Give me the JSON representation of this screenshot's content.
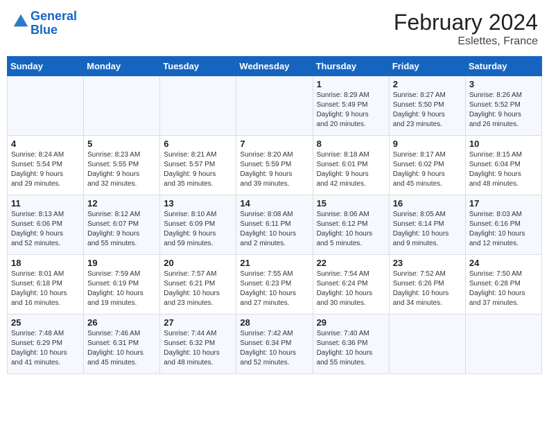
{
  "header": {
    "logo_text1": "General",
    "logo_text2": "Blue",
    "title": "February 2024",
    "subtitle": "Eslettes, France"
  },
  "days_of_week": [
    "Sunday",
    "Monday",
    "Tuesday",
    "Wednesday",
    "Thursday",
    "Friday",
    "Saturday"
  ],
  "weeks": [
    [
      {
        "day": "",
        "info": ""
      },
      {
        "day": "",
        "info": ""
      },
      {
        "day": "",
        "info": ""
      },
      {
        "day": "",
        "info": ""
      },
      {
        "day": "1",
        "info": "Sunrise: 8:29 AM\nSunset: 5:49 PM\nDaylight: 9 hours\nand 20 minutes."
      },
      {
        "day": "2",
        "info": "Sunrise: 8:27 AM\nSunset: 5:50 PM\nDaylight: 9 hours\nand 23 minutes."
      },
      {
        "day": "3",
        "info": "Sunrise: 8:26 AM\nSunset: 5:52 PM\nDaylight: 9 hours\nand 26 minutes."
      }
    ],
    [
      {
        "day": "4",
        "info": "Sunrise: 8:24 AM\nSunset: 5:54 PM\nDaylight: 9 hours\nand 29 minutes."
      },
      {
        "day": "5",
        "info": "Sunrise: 8:23 AM\nSunset: 5:55 PM\nDaylight: 9 hours\nand 32 minutes."
      },
      {
        "day": "6",
        "info": "Sunrise: 8:21 AM\nSunset: 5:57 PM\nDaylight: 9 hours\nand 35 minutes."
      },
      {
        "day": "7",
        "info": "Sunrise: 8:20 AM\nSunset: 5:59 PM\nDaylight: 9 hours\nand 39 minutes."
      },
      {
        "day": "8",
        "info": "Sunrise: 8:18 AM\nSunset: 6:01 PM\nDaylight: 9 hours\nand 42 minutes."
      },
      {
        "day": "9",
        "info": "Sunrise: 8:17 AM\nSunset: 6:02 PM\nDaylight: 9 hours\nand 45 minutes."
      },
      {
        "day": "10",
        "info": "Sunrise: 8:15 AM\nSunset: 6:04 PM\nDaylight: 9 hours\nand 48 minutes."
      }
    ],
    [
      {
        "day": "11",
        "info": "Sunrise: 8:13 AM\nSunset: 6:06 PM\nDaylight: 9 hours\nand 52 minutes."
      },
      {
        "day": "12",
        "info": "Sunrise: 8:12 AM\nSunset: 6:07 PM\nDaylight: 9 hours\nand 55 minutes."
      },
      {
        "day": "13",
        "info": "Sunrise: 8:10 AM\nSunset: 6:09 PM\nDaylight: 9 hours\nand 59 minutes."
      },
      {
        "day": "14",
        "info": "Sunrise: 8:08 AM\nSunset: 6:11 PM\nDaylight: 10 hours\nand 2 minutes."
      },
      {
        "day": "15",
        "info": "Sunrise: 8:06 AM\nSunset: 6:12 PM\nDaylight: 10 hours\nand 5 minutes."
      },
      {
        "day": "16",
        "info": "Sunrise: 8:05 AM\nSunset: 6:14 PM\nDaylight: 10 hours\nand 9 minutes."
      },
      {
        "day": "17",
        "info": "Sunrise: 8:03 AM\nSunset: 6:16 PM\nDaylight: 10 hours\nand 12 minutes."
      }
    ],
    [
      {
        "day": "18",
        "info": "Sunrise: 8:01 AM\nSunset: 6:18 PM\nDaylight: 10 hours\nand 16 minutes."
      },
      {
        "day": "19",
        "info": "Sunrise: 7:59 AM\nSunset: 6:19 PM\nDaylight: 10 hours\nand 19 minutes."
      },
      {
        "day": "20",
        "info": "Sunrise: 7:57 AM\nSunset: 6:21 PM\nDaylight: 10 hours\nand 23 minutes."
      },
      {
        "day": "21",
        "info": "Sunrise: 7:55 AM\nSunset: 6:23 PM\nDaylight: 10 hours\nand 27 minutes."
      },
      {
        "day": "22",
        "info": "Sunrise: 7:54 AM\nSunset: 6:24 PM\nDaylight: 10 hours\nand 30 minutes."
      },
      {
        "day": "23",
        "info": "Sunrise: 7:52 AM\nSunset: 6:26 PM\nDaylight: 10 hours\nand 34 minutes."
      },
      {
        "day": "24",
        "info": "Sunrise: 7:50 AM\nSunset: 6:28 PM\nDaylight: 10 hours\nand 37 minutes."
      }
    ],
    [
      {
        "day": "25",
        "info": "Sunrise: 7:48 AM\nSunset: 6:29 PM\nDaylight: 10 hours\nand 41 minutes."
      },
      {
        "day": "26",
        "info": "Sunrise: 7:46 AM\nSunset: 6:31 PM\nDaylight: 10 hours\nand 45 minutes."
      },
      {
        "day": "27",
        "info": "Sunrise: 7:44 AM\nSunset: 6:32 PM\nDaylight: 10 hours\nand 48 minutes."
      },
      {
        "day": "28",
        "info": "Sunrise: 7:42 AM\nSunset: 6:34 PM\nDaylight: 10 hours\nand 52 minutes."
      },
      {
        "day": "29",
        "info": "Sunrise: 7:40 AM\nSunset: 6:36 PM\nDaylight: 10 hours\nand 55 minutes."
      },
      {
        "day": "",
        "info": ""
      },
      {
        "day": "",
        "info": ""
      }
    ]
  ]
}
